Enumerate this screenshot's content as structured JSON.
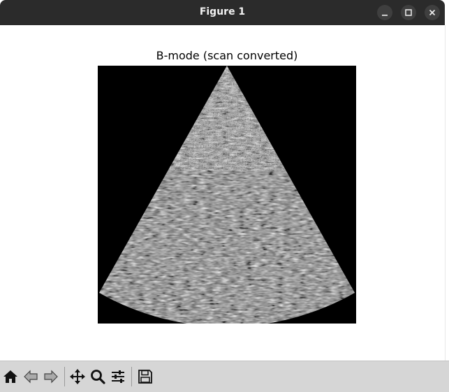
{
  "window": {
    "title": "Figure 1",
    "buttons": {
      "minimize": "minimize-icon",
      "maximize": "maximize-icon",
      "close": "close-icon"
    }
  },
  "figure": {
    "axes_title": "B-mode (scan converted)",
    "image": "ultrasound-sector-speckle",
    "background": "#000000"
  },
  "toolbar": {
    "items": [
      {
        "name": "home",
        "icon": "home-icon"
      },
      {
        "name": "back",
        "icon": "back-arrow-icon"
      },
      {
        "name": "forward",
        "icon": "forward-arrow-icon"
      },
      {
        "name": "pan",
        "icon": "move-icon"
      },
      {
        "name": "zoom",
        "icon": "zoom-icon"
      },
      {
        "name": "configure-subplots",
        "icon": "sliders-icon"
      },
      {
        "name": "save",
        "icon": "save-icon"
      }
    ]
  },
  "colors": {
    "titlebar": "#2b2b2b",
    "toolbar": "#d6d6d6",
    "axes_bg": "#000000"
  }
}
